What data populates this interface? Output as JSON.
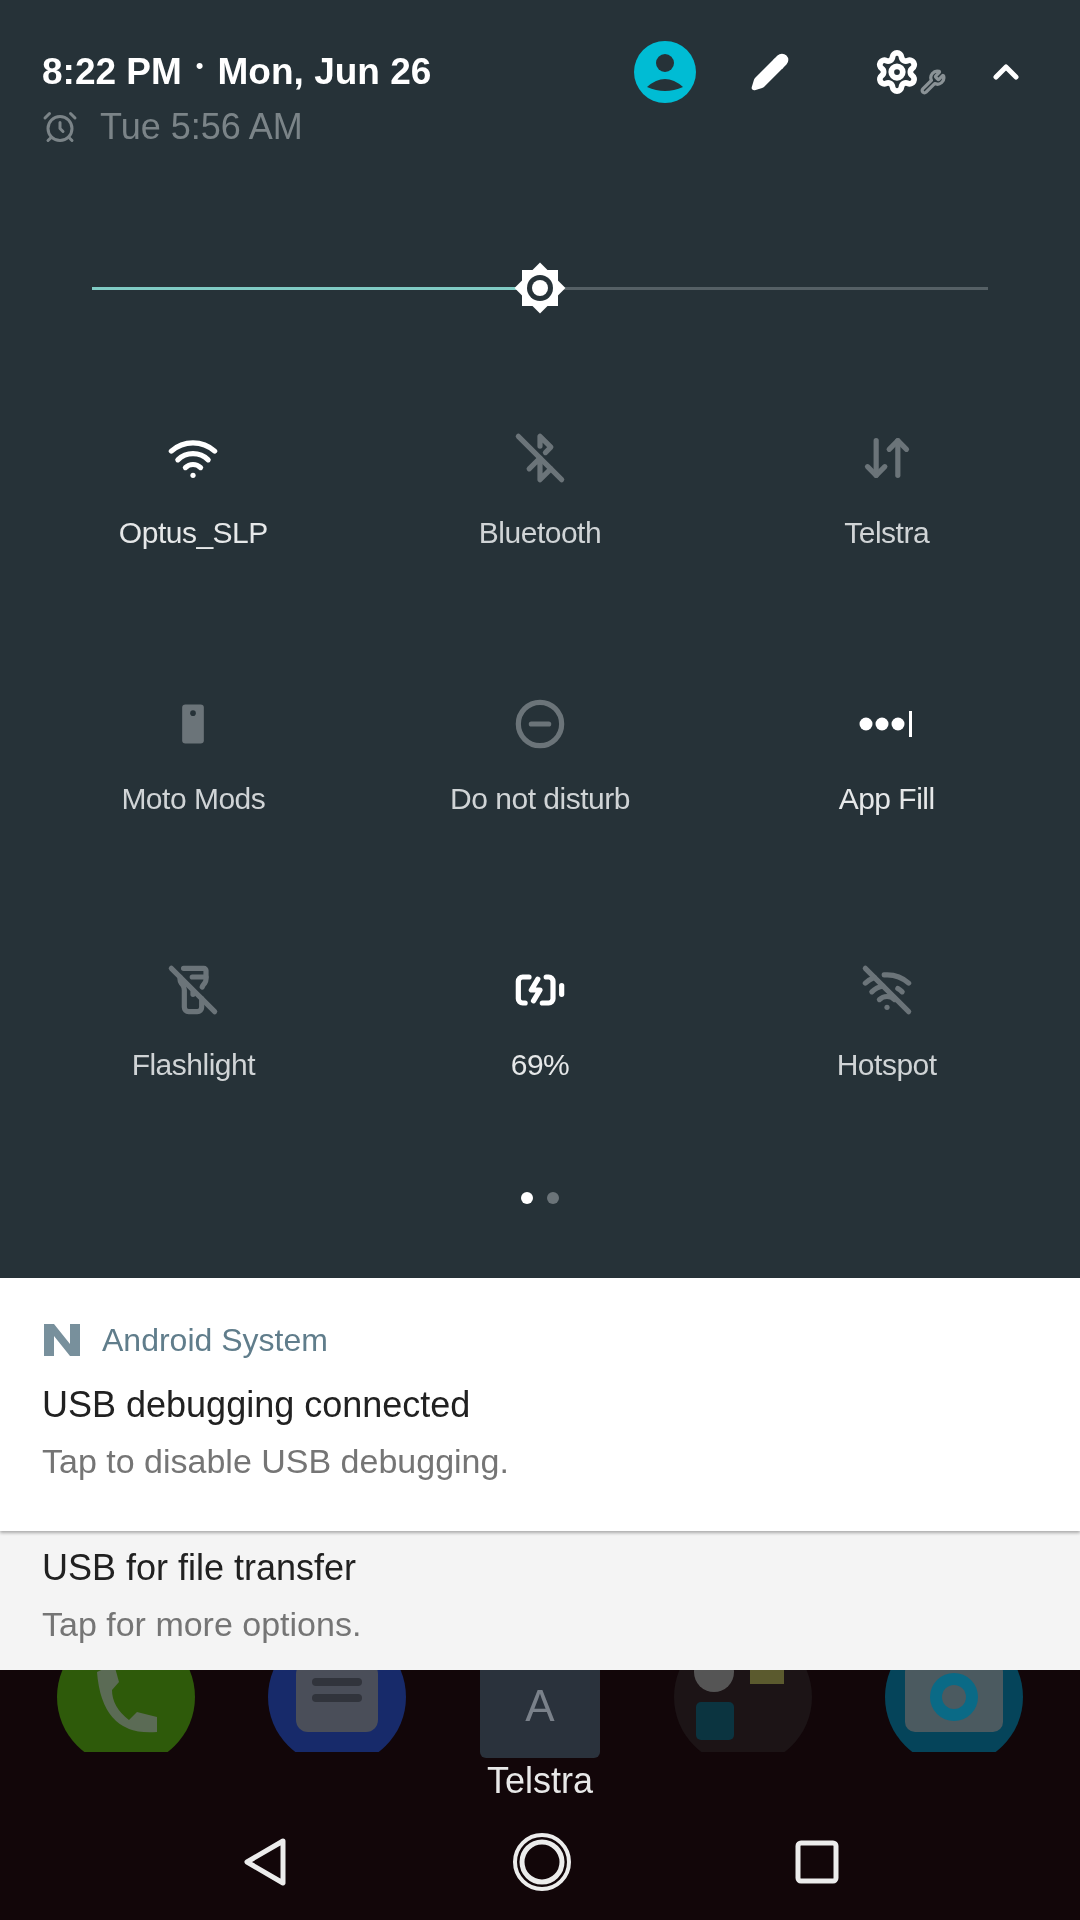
{
  "header": {
    "time": "8:22 PM",
    "separator": "•",
    "date": "Mon, Jun 26",
    "alarm": "Tue 5:56 AM"
  },
  "brightness": {
    "level": 0.5
  },
  "tiles": [
    {
      "kind": "wifi",
      "label": "Optus_SLP",
      "on": true
    },
    {
      "kind": "bluetooth",
      "label": "Bluetooth",
      "on": false
    },
    {
      "kind": "data",
      "label": "Telstra",
      "on": false
    },
    {
      "kind": "mods",
      "label": "Moto Mods",
      "on": false
    },
    {
      "kind": "dnd",
      "label": "Do not disturb",
      "on": false
    },
    {
      "kind": "appfill",
      "label": "App Fill",
      "on": true
    },
    {
      "kind": "flashlight",
      "label": "Flashlight",
      "on": false
    },
    {
      "kind": "battery",
      "label": "69%",
      "on": true
    },
    {
      "kind": "hotspot",
      "label": "Hotspot",
      "on": false
    }
  ],
  "pages": [
    {
      "selected": true
    },
    {
      "selected": false
    }
  ],
  "notifications": [
    {
      "app": "Android System",
      "title": "USB debugging connected",
      "text": "Tap to disable USB debugging.",
      "expanded": true
    },
    {
      "title": "USB for file transfer",
      "text": "Tap for more options.",
      "expanded": false
    }
  ],
  "dock": {
    "folder_letter": "A",
    "label": "Telstra"
  }
}
